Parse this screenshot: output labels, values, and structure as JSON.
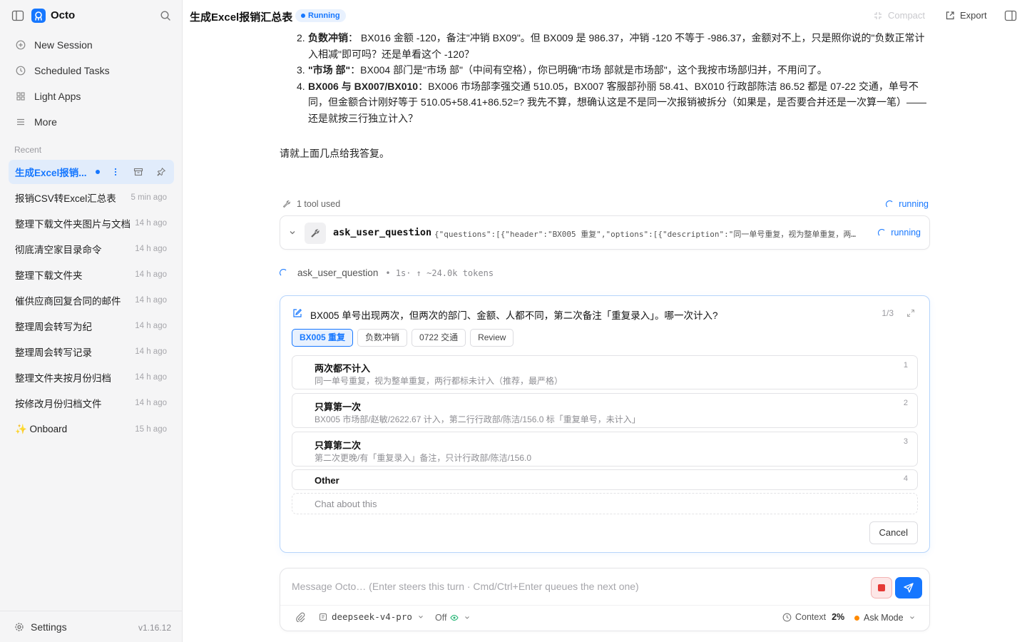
{
  "app": {
    "name": "Octo",
    "version": "v1.16.12"
  },
  "sidebar": {
    "nav": [
      {
        "label": "New Session",
        "icon": "plus-circle-icon"
      },
      {
        "label": "Scheduled Tasks",
        "icon": "clock-icon"
      },
      {
        "label": "Light Apps",
        "icon": "grid-icon"
      },
      {
        "label": "More",
        "icon": "menu-icon"
      }
    ],
    "recent_label": "Recent",
    "recent": [
      {
        "title": "生成Excel报销...",
        "ago": "",
        "active": true
      },
      {
        "title": "报销CSV转Excel汇总表",
        "ago": "5 min ago"
      },
      {
        "title": "整理下载文件夹图片与文档",
        "ago": "14 h ago"
      },
      {
        "title": "彻底清空家目录命令",
        "ago": "14 h ago"
      },
      {
        "title": "整理下载文件夹",
        "ago": "14 h ago"
      },
      {
        "title": "催供应商回复合同的邮件",
        "ago": "14 h ago"
      },
      {
        "title": "整理周会转写为纪",
        "ago": "14 h ago"
      },
      {
        "title": "整理周会转写记录",
        "ago": "14 h ago"
      },
      {
        "title": "整理文件夹按月份归档",
        "ago": "14 h ago"
      },
      {
        "title": "按修改月份归档文件",
        "ago": "14 h ago"
      },
      {
        "title": "✨ Onboard",
        "ago": "15 h ago"
      }
    ],
    "settings_label": "Settings"
  },
  "topbar": {
    "title": "生成Excel报销汇总表",
    "status": "Running",
    "compact_label": "Compact",
    "export_label": "Export"
  },
  "message": {
    "items": [
      {
        "num": "2.",
        "bold": "负数冲销",
        "text": "：  BX016  金额 -120，备注\"冲销 BX09\"。但 BX009 是 986.37，冲销 -120 不等于 -986.37，金额对不上，只是照你说的\"负数正常计入相减\"即可吗？还是单看这个 -120？"
      },
      {
        "num": "3.",
        "bold": "\"市场 部\"",
        "text": "：BX004 部门是\"市场 部\"（中间有空格），你已明确\"市场 部就是市场部\"，这个我按市场部归并，不用问了。"
      },
      {
        "num": "4.",
        "bold": "BX006 与 BX007/BX010",
        "text": "：BX006 市场部李强交通 510.05，BX007 客服部孙丽 58.41、BX010 行政部陈洁 86.52 都是 07-22 交通，单号不同，但金额合计刚好等于 510.05+58.41+86.52=? 我先不算，想确认这是不是同一次报销被拆分（如果是，是否要合并还是一次算一笔）——还是就按三行独立计入？"
      }
    ],
    "closing": "请就上面几点给我答复。"
  },
  "tools": {
    "used_label": "1 tool used",
    "status": "running",
    "call_name": "ask_user_question",
    "call_args": "{\"questions\":[{\"header\":\"BX005 重复\",\"options\":[{\"description\":\"同一单号重复，视为整单重复，两…",
    "stream_name": "ask_user_question",
    "stream_meta": "• 1s· ↑ ~24.0k tokens"
  },
  "question": {
    "text": "BX005 单号出现两次，但两次的部门、金额、人都不同，第二次备注「重复录入」。哪一次计入?",
    "page": "1/3",
    "tabs": [
      "BX005 重复",
      "负数冲销",
      "0722 交通",
      "Review"
    ],
    "options": [
      {
        "title": "两次都不计入",
        "desc": "同一单号重复，视为整单重复，两行都标未计入（推荐，最严格）",
        "num": "1"
      },
      {
        "title": "只算第一次",
        "desc": "BX005 市场部/赵敏/2622.67 计入，第二行行政部/陈洁/156.0 标「重复单号，未计入」",
        "num": "2"
      },
      {
        "title": "只算第二次",
        "desc": "第二次更晚/有「重复录入」备注，只计行政部/陈洁/156.0",
        "num": "3"
      },
      {
        "title": "Other",
        "desc": "",
        "num": "4"
      }
    ],
    "chat_label": "Chat about this",
    "cancel_label": "Cancel"
  },
  "composer": {
    "placeholder": "Message Octo… (Enter steers this turn · Cmd/Ctrl+Enter queues the next one)",
    "model": "deepseek-v4-pro",
    "thinking": "Off",
    "context_label": "Context",
    "context_value": "2%",
    "mode": "Ask Mode"
  },
  "colors": {
    "accent": "#1677ff",
    "stop": "#e53935",
    "mode_dot": "#ff8a00"
  }
}
